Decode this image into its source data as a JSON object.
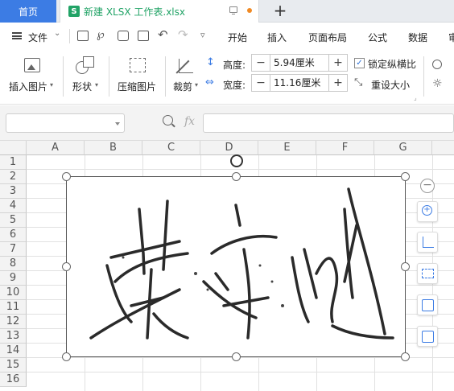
{
  "tabs": {
    "home_label": "首页",
    "doc_label": "新建 XLSX 工作表.xlsx",
    "app_letter": "S",
    "new_tab_symbol": "+"
  },
  "menu": {
    "file_label": "文件",
    "items": [
      "开始",
      "插入",
      "页面布局",
      "公式",
      "数据",
      "审"
    ]
  },
  "ribbon": {
    "insert_picture_label": "插入图片",
    "shape_label": "形状",
    "compress_label": "压缩图片",
    "crop_label": "裁剪",
    "height_label": "高度:",
    "height_value": "5.94厘米",
    "width_label": "宽度:",
    "width_value": "11.16厘米",
    "lock_ratio_label": "锁定纵横比",
    "lock_ratio_checked": true,
    "reset_size_label": "重设大小",
    "minus": "−",
    "plus": "+"
  },
  "formula_bar": {
    "name_box": "",
    "fx_label": "fx",
    "formula": ""
  },
  "sheet": {
    "columns": [
      "A",
      "B",
      "C",
      "D",
      "E",
      "F",
      "G"
    ],
    "rows": [
      "1",
      "2",
      "3",
      "4",
      "5",
      "6",
      "7",
      "8",
      "9",
      "10",
      "11",
      "12",
      "13",
      "14",
      "15",
      "16"
    ]
  },
  "picture": {
    "content": "signature-image"
  },
  "side_tools": [
    "zoom-in-icon",
    "crop-icon",
    "picture-frame-icon",
    "image-convert-icon",
    "image-replace-icon"
  ],
  "colors": {
    "accent": "#3c7ce4",
    "sheet_green": "#21a366"
  }
}
